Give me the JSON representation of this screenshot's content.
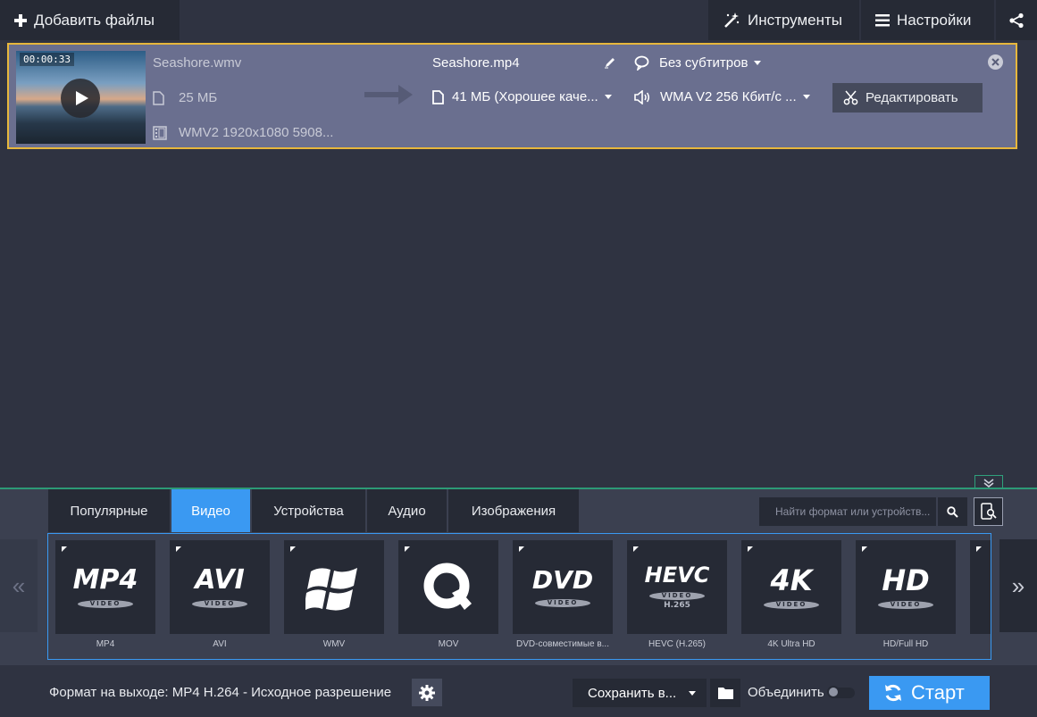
{
  "toolbar": {
    "add_files": "Добавить файлы",
    "tools": "Инструменты",
    "settings": "Настройки"
  },
  "file": {
    "thumb_time": "00:00:33",
    "source_name": "Seashore.wmv",
    "source_size": "25 МБ",
    "source_info": "WMV2 1920x1080 5908...",
    "output_name": "Seashore.mp4",
    "output_size": "41 МБ (Хорошее каче...",
    "subtitles": "Без субтитров",
    "audio": "WMA V2 256 Кбит/с ...",
    "edit": "Редактировать"
  },
  "tabs": [
    "Популярные",
    "Видео",
    "Устройства",
    "Аудио",
    "Изображения"
  ],
  "active_tab": "Видео",
  "search_placeholder": "Найти формат или устройств...",
  "formats": [
    {
      "label": "MP4",
      "logo": "MP4",
      "sub": "VIDEO"
    },
    {
      "label": "AVI",
      "logo": "AVI",
      "sub": "VIDEO"
    },
    {
      "label": "WMV",
      "logo": "windows-logo-icon",
      "sub": ""
    },
    {
      "label": "MOV",
      "logo": "quicktime-logo-icon",
      "sub": ""
    },
    {
      "label": "DVD-совместимые в...",
      "logo": "DVD",
      "sub": "VIDEO"
    },
    {
      "label": "HEVC (H.265)",
      "logo": "HEVC",
      "sub": "VIDEO",
      "extra": "H.265"
    },
    {
      "label": "4K Ultra HD",
      "logo": "4K",
      "sub": "VIDEO"
    },
    {
      "label": "HD/Full HD",
      "logo": "HD",
      "sub": "VIDEO"
    }
  ],
  "nav": {
    "prev": "«",
    "next": "»"
  },
  "status": {
    "output_format": "Формат на выходе: MP4 H.264 - Исходное разрешение",
    "save_to": "Сохранить в...",
    "merge": "Объединить",
    "start": "Старт"
  },
  "colors": {
    "accent": "#3a99f2",
    "selection_border": "#e7b73c",
    "divider": "#2c9a76"
  }
}
